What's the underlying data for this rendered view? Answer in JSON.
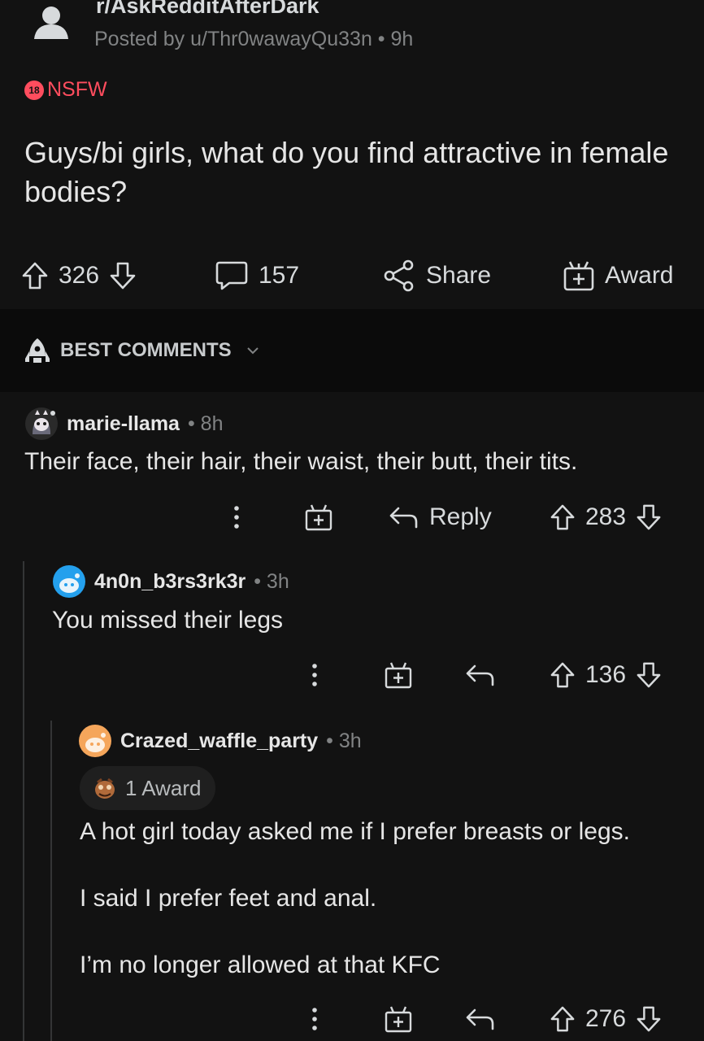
{
  "post": {
    "subreddit": "r/AskRedditAfterDark",
    "byline": "Posted by u/Thr0wawayQu33n • 9h",
    "nsfw_badge": "18",
    "nsfw_label": "NSFW",
    "title": "Guys/bi girls, what do you find attractive in female bodies?",
    "upvotes": "326",
    "comments": "157",
    "share_label": "Share",
    "award_label": "Award"
  },
  "sort": {
    "label": "BEST COMMENTS"
  },
  "comments": [
    {
      "user": "marie-llama",
      "age": "• 8h",
      "body": "Their face, their hair, their waist, their butt, their tits.",
      "reply_label": "Reply",
      "score": "283"
    },
    {
      "user": "4n0n_b3rs3rk3r",
      "age": "• 3h",
      "body": "You missed their legs",
      "score": "136"
    },
    {
      "user": "Crazed_waffle_party",
      "age": "• 3h",
      "awards": "1 Award",
      "body_lines": [
        "A hot girl today asked me if I prefer breasts or legs.",
        "I said I prefer feet and anal.",
        "I’m no longer allowed at that KFC"
      ],
      "score": "276"
    }
  ],
  "colors": {
    "background": "#121212",
    "nsfw": "#ff4d5e",
    "avatar_teal": "#24a0ed",
    "avatar_orange": "#f5a65b",
    "muted": "#818384"
  }
}
